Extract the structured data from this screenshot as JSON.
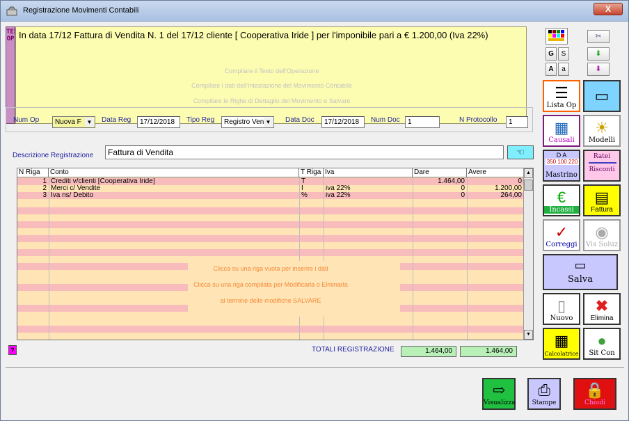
{
  "window": {
    "title": "Registrazione Movimenti Contabili",
    "close_label": "X"
  },
  "text_side_label": "TESTO OP",
  "operation_text": "In data 17/12   Fattura di Vendita N. 1 del 17/12 cliente [ Cooperativa Iride ] per l'imponibile pari a € 1.200,00 (Iva 22%)",
  "text_hints": [
    "Compilare il Testo dell'Operazione",
    "Compilare i dati dell'Intestazione del Movimento Contabile",
    "Compilare le Righe di Dettaglio del Movimento e Salvare"
  ],
  "toolbar_small": {
    "g": "G",
    "s": "S",
    "a_big": "A",
    "a_small": "a"
  },
  "header": {
    "num_op_label": "Num Op",
    "num_op_value": "Nuova F",
    "data_reg_label": "Data Reg",
    "data_reg_value": "17/12/2018",
    "tipo_reg_label": "Tipo Reg",
    "tipo_reg_value": "Registro Venc",
    "data_doc_label": "Data Doc",
    "data_doc_value": "17/12/2018",
    "num_doc_label": "Num Doc",
    "num_doc_value": "1",
    "n_protocollo_label": "N Protocollo",
    "n_protocollo_value": "1"
  },
  "description": {
    "label": "Descrizione Registrazione",
    "value": "Fattura di Vendita"
  },
  "grid": {
    "columns": [
      "N Riga",
      "Conto",
      "T Riga",
      "Iva",
      "Dare",
      "Avere"
    ],
    "rows": [
      {
        "n": "1",
        "conto": "Crediti v/clienti [Cooperativa Iride]",
        "t": "T",
        "iva": "",
        "dare": "1.464,00",
        "avere": "0"
      },
      {
        "n": "2",
        "conto": "Merci c/ Vendite",
        "t": "I",
        "iva": "iva 22%",
        "dare": "0",
        "avere": "1.200,00"
      },
      {
        "n": "3",
        "conto": "Iva ns/ Debito",
        "t": "%",
        "iva": "iva 22%",
        "dare": "0",
        "avere": "264,00"
      }
    ],
    "hints": [
      "Clicca su una riga vuota per inserire i dati",
      "Clicca su una riga compilata per Modificarla o Elminarla",
      "al termine delle modifiche SALVARE"
    ]
  },
  "totals": {
    "label": "TOTALI REGISTRAZIONE",
    "dare": "1.464,00",
    "avere": "1.464,00"
  },
  "help_label": "?",
  "side_buttons": {
    "lista_op": "Lista Op",
    "causali": "Causali",
    "modelli": "Modelli",
    "mastrino": "Mastrino",
    "mastrino_top": "D  A",
    "mastrino_nums": "350 100 220",
    "ratei": "Ratei",
    "risconti": "Risconti",
    "incassi": "Incassi",
    "fattura": "Fattura",
    "correggi": "Correggi",
    "vis_soluz": "Vis Soluz",
    "salva": "Salva",
    "nuovo": "Nuovo",
    "elimina": "Elimina",
    "calcolatrice": "Calcolatrice",
    "sit_con": "Sit Con"
  },
  "footer_buttons": {
    "visualizza": "Visualizza",
    "stampe": "Stampe",
    "chiudi": "Chiudi"
  }
}
